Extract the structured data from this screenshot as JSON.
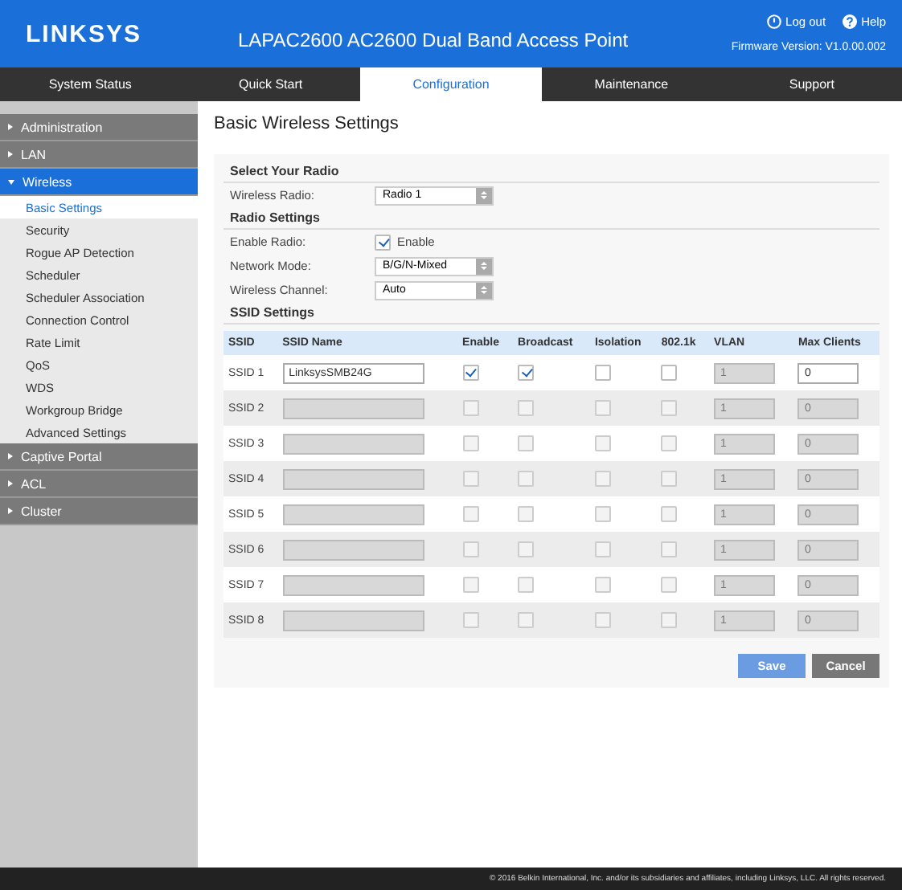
{
  "header": {
    "logo": "LINKSYS",
    "title": "LAPAC2600 AC2600 Dual Band Access Point",
    "links": [
      {
        "kind": "logout",
        "label": "Log out"
      },
      {
        "kind": "help",
        "label": "Help"
      }
    ],
    "firmware": "Firmware Version: V1.0.00.002"
  },
  "nav": [
    {
      "label": "System Status",
      "selected": false
    },
    {
      "label": "Quick Start",
      "selected": false
    },
    {
      "label": "Configuration",
      "selected": true
    },
    {
      "label": "Maintenance",
      "selected": false
    },
    {
      "label": "Support",
      "selected": false
    }
  ],
  "sidebar": [
    {
      "label": "Administration",
      "expanded": false
    },
    {
      "label": "LAN",
      "expanded": false
    },
    {
      "label": "Wireless",
      "expanded": true,
      "children": [
        {
          "label": "Basic Settings",
          "selected": true
        },
        {
          "label": "Security",
          "selected": false
        },
        {
          "label": "Rogue AP Detection",
          "selected": false
        },
        {
          "label": "Scheduler",
          "selected": false
        },
        {
          "label": "Scheduler Association",
          "selected": false
        },
        {
          "label": "Connection Control",
          "selected": false
        },
        {
          "label": "Rate Limit",
          "selected": false
        },
        {
          "label": "QoS",
          "selected": false
        },
        {
          "label": "WDS",
          "selected": false
        },
        {
          "label": "Workgroup Bridge",
          "selected": false
        },
        {
          "label": "Advanced Settings",
          "selected": false
        }
      ]
    },
    {
      "label": "Captive Portal",
      "expanded": false
    },
    {
      "label": "ACL",
      "expanded": false
    },
    {
      "label": "Cluster",
      "expanded": false
    }
  ],
  "page_title": "Basic Wireless Settings",
  "sections": [
    {
      "heading": "Select Your Radio",
      "fields": [
        {
          "kind": "select",
          "label": "Wireless Radio:",
          "value": "Radio 1"
        }
      ]
    },
    {
      "heading": "Radio Settings",
      "fields": [
        {
          "kind": "checkbox",
          "label": "Enable Radio:",
          "text": "Enable",
          "checked": true
        },
        {
          "kind": "select",
          "label": "Network Mode:",
          "value": "B/G/N-Mixed"
        },
        {
          "kind": "select",
          "label": "Wireless Channel:",
          "value": "Auto"
        }
      ]
    }
  ],
  "ssid_heading": "SSID Settings",
  "columns": [
    "SSID",
    "SSID Name",
    "Enable",
    "Broadcast",
    "Isolation",
    "802.1k",
    "VLAN",
    "Max Clients"
  ],
  "rows": [
    {
      "ssid": "SSID 1",
      "disabled": false,
      "name": "LinksysSMB24G",
      "enable": true,
      "broadcast": true,
      "isolation": false,
      "dot1k": false,
      "vlan": "1",
      "max_clients": "0"
    },
    {
      "ssid": "SSID 2",
      "disabled": true,
      "enable": false,
      "broadcast": false,
      "isolation": false,
      "dot1k": false,
      "vlan": "1",
      "max_clients": "0"
    },
    {
      "ssid": "SSID 3",
      "disabled": true,
      "enable": false,
      "broadcast": false,
      "isolation": false,
      "dot1k": false,
      "vlan": "1",
      "max_clients": "0"
    },
    {
      "ssid": "SSID 4",
      "disabled": true,
      "enable": false,
      "broadcast": false,
      "isolation": false,
      "dot1k": false,
      "vlan": "1",
      "max_clients": "0"
    },
    {
      "ssid": "SSID 5",
      "disabled": true,
      "enable": false,
      "broadcast": false,
      "isolation": false,
      "dot1k": false,
      "vlan": "1",
      "max_clients": "0"
    },
    {
      "ssid": "SSID 6",
      "disabled": true,
      "enable": false,
      "broadcast": false,
      "isolation": false,
      "dot1k": false,
      "vlan": "1",
      "max_clients": "0"
    },
    {
      "ssid": "SSID 7",
      "disabled": true,
      "enable": false,
      "broadcast": false,
      "isolation": false,
      "dot1k": false,
      "vlan": "1",
      "max_clients": "0"
    },
    {
      "ssid": "SSID 8",
      "disabled": true,
      "enable": false,
      "broadcast": false,
      "isolation": false,
      "dot1k": false,
      "vlan": "1",
      "max_clients": "0"
    }
  ],
  "buttons": [
    {
      "kind": "primary",
      "label": "Save"
    },
    {
      "kind": "secondary",
      "label": "Cancel"
    }
  ],
  "footer": "© 2016 Belkin International, Inc. and/or its subsidiaries and affiliates, including Linksys, LLC. All rights reserved."
}
